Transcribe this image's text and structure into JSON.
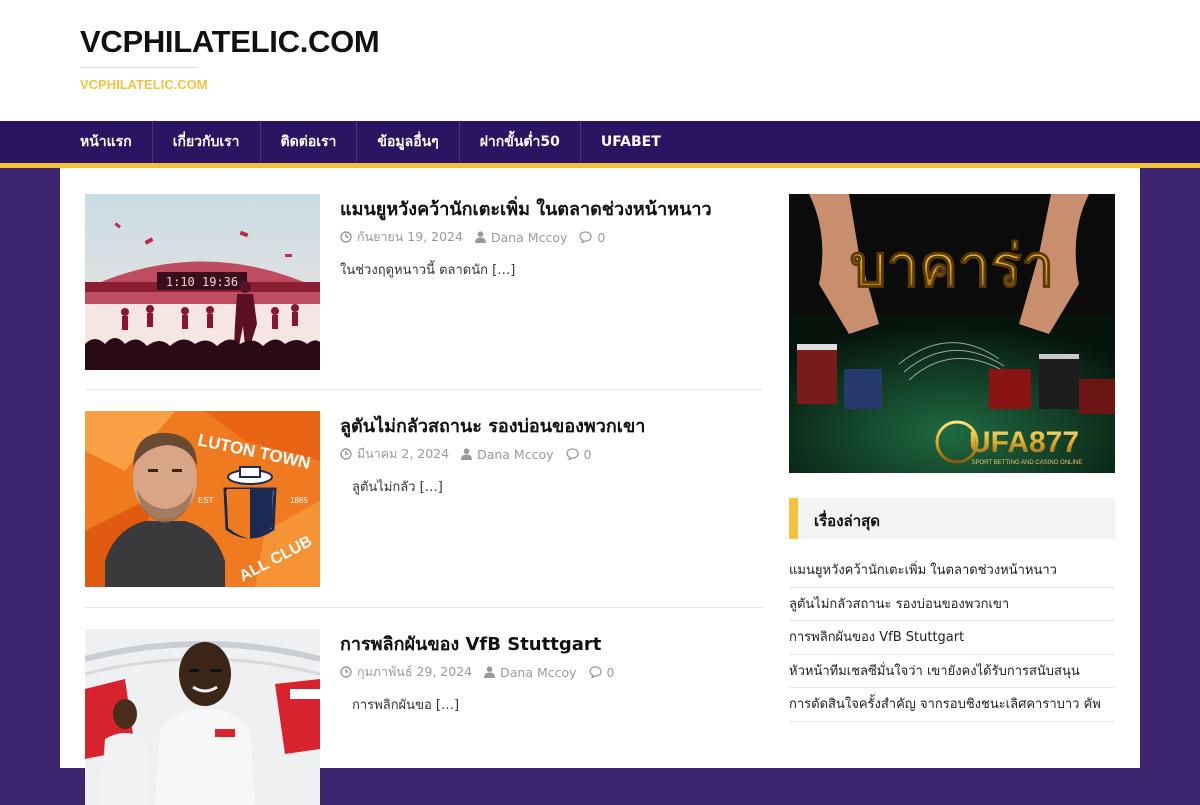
{
  "site": {
    "title": "VCPHILATELIC.COM",
    "tagline": "VCPHILATELIC.COM"
  },
  "nav": {
    "items": [
      {
        "label": "หน้าแรก"
      },
      {
        "label": "เกี่ยวกับเรา"
      },
      {
        "label": "ติดต่อเรา"
      },
      {
        "label": "ข้อมูลอื่นๆ"
      },
      {
        "label": "ฝากขั้นต่ำ50"
      },
      {
        "label": "UFABET"
      }
    ]
  },
  "posts": [
    {
      "title": "แมนยูหวังคว้านักเตะเพิ่ม ในตลาดช่วงหน้าหนาว",
      "date": "กันยายน 19, 2024",
      "author": "Dana Mccoy",
      "comments": "0",
      "excerpt": "ในช่วงฤดูหนาวนี้ ตลาดนัก […]",
      "thumb_text": "1:10 19:36"
    },
    {
      "title": "ลูตันไม่กลัวสถานะ รองบ่อนของพวกเขา",
      "date": "มีนาคม 2, 2024",
      "author": "Dana Mccoy",
      "comments": "0",
      "excerpt": "ลูตันไม่กลัว […]",
      "thumb_text_top": "LUTON TOWN",
      "thumb_text_bottom": "ALL CLUB",
      "thumb_left": "EST",
      "thumb_right": "1885"
    },
    {
      "title": "การพลิกผันของ VfB Stuttgart",
      "date": "กุมภาพันธ์ 29, 2024",
      "author": "Dana Mccoy",
      "comments": "0",
      "excerpt": "การพลิกผันขอ […]"
    }
  ],
  "sidebar": {
    "ad": {
      "headline": "บาคาร่า",
      "brand": "UFA877",
      "slogan": "SPORT BETTING AND CASINO ONLINE"
    },
    "recent_title": "เรื่องล่าสุด",
    "recent_items": [
      {
        "label": "แมนยูหวังคว้านักเตะเพิ่ม ในตลาดช่วงหน้าหนาว"
      },
      {
        "label": "ลูตันไม่กลัวสถานะ รองบ่อนของพวกเขา"
      },
      {
        "label": "การพลิกผันของ VfB Stuttgart"
      },
      {
        "label": "หัวหน้าทีมเชลซีมั่นใจว่า เขายังคงได้รับการสนับสนุน"
      },
      {
        "label": "การตัดสินใจครั้งสำคัญ จากรอบชิงชนะเลิศคาราบาว คัพ"
      }
    ]
  },
  "colors": {
    "accent": "#f5c33b",
    "nav_bg": "#2b1563",
    "page_bg": "#3d2570"
  }
}
